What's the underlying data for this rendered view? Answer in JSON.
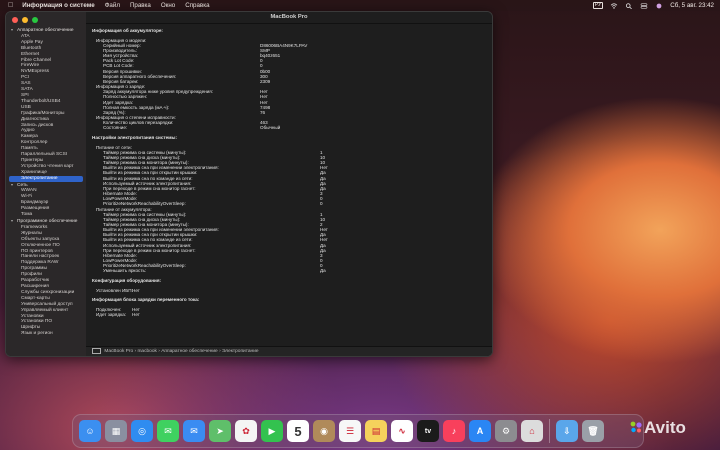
{
  "menubar": {
    "app_name": "Информация о системе",
    "items": [
      "Файл",
      "Правка",
      "Окно",
      "Справка"
    ],
    "input_badge": "РУ",
    "clock": "Сб, 5 авг. 23:42"
  },
  "window": {
    "title": "MacBook Pro",
    "sidebar": [
      {
        "label": "Аппаратное обеспечение",
        "type": "cat"
      },
      {
        "label": "ATA"
      },
      {
        "label": "Apple Pay"
      },
      {
        "label": "Bluetooth"
      },
      {
        "label": "Ethernet"
      },
      {
        "label": "Fibre Channel"
      },
      {
        "label": "FireWire"
      },
      {
        "label": "NVMExpress"
      },
      {
        "label": "PCI"
      },
      {
        "label": "SAS"
      },
      {
        "label": "SATA"
      },
      {
        "label": "SPI"
      },
      {
        "label": "Thunderbolt/USB4"
      },
      {
        "label": "USB"
      },
      {
        "label": "Графика/Мониторы"
      },
      {
        "label": "Диагностика"
      },
      {
        "label": "Запись дисков"
      },
      {
        "label": "Аудио"
      },
      {
        "label": "Камера"
      },
      {
        "label": "Контроллер"
      },
      {
        "label": "Память"
      },
      {
        "label": "Параллельный SCSI"
      },
      {
        "label": "Принтеры"
      },
      {
        "label": "Устройство чтения карт"
      },
      {
        "label": "Хранилище"
      },
      {
        "label": "Электропитание",
        "type": "sel"
      },
      {
        "label": "Сеть",
        "type": "cat"
      },
      {
        "label": "WWAN"
      },
      {
        "label": "Wi-Fi"
      },
      {
        "label": "Брандмауэр"
      },
      {
        "label": "Размещения"
      },
      {
        "label": "Тома"
      },
      {
        "label": "Программное обеспечение",
        "type": "cat"
      },
      {
        "label": "Frameworks"
      },
      {
        "label": "Журналы"
      },
      {
        "label": "Объекты запуска"
      },
      {
        "label": "Отключенное ПО"
      },
      {
        "label": "ПО принтеров"
      },
      {
        "label": "Панели настроек"
      },
      {
        "label": "Поддержка RAW"
      },
      {
        "label": "Программы"
      },
      {
        "label": "Профили"
      },
      {
        "label": "Разработчик"
      },
      {
        "label": "Расширения"
      },
      {
        "label": "Службы синхронизации"
      },
      {
        "label": "Смарт-карты"
      },
      {
        "label": "Универсальный доступ"
      },
      {
        "label": "Управляемый клиент"
      },
      {
        "label": "Установки"
      },
      {
        "label": "Установки ПО"
      },
      {
        "label": "Шрифты"
      },
      {
        "label": "Язык и регион"
      }
    ],
    "rows": [
      {
        "k": "Информация об аккумуляторе:",
        "v": "",
        "ind": 0,
        "h": true
      },
      {
        "gap": true
      },
      {
        "k": "Информация о модели:",
        "v": "",
        "ind": 1
      },
      {
        "k": "Серийный номер:",
        "v": "D86006BA4N9K7LPAV",
        "ind": 2
      },
      {
        "k": "Производитель:",
        "v": "SMP",
        "ind": 2
      },
      {
        "k": "Имя устройства:",
        "v": "bq40z651",
        "ind": 2
      },
      {
        "k": "Pack Lot Code:",
        "v": "0",
        "ind": 2
      },
      {
        "k": "PCB Lot Code:",
        "v": "0",
        "ind": 2
      },
      {
        "k": "Версия прошивки:",
        "v": "0b00",
        "ind": 2
      },
      {
        "k": "Версия аппаратного обеспечения:",
        "v": "300",
        "ind": 2
      },
      {
        "k": "Версия батареи:",
        "v": "2309",
        "ind": 2
      },
      {
        "k": "Информация о заряде:",
        "v": "",
        "ind": 1
      },
      {
        "k": "Заряд аккумулятора ниже уровня предупреждения:",
        "v": "Нет",
        "ind": 2
      },
      {
        "k": "Полностью заряжен:",
        "v": "Нет",
        "ind": 2
      },
      {
        "k": "Идет зарядка:",
        "v": "Нет",
        "ind": 2
      },
      {
        "k": "Полная емкость заряда (мА·ч):",
        "v": "7498",
        "ind": 2
      },
      {
        "k": "Заряд (%):",
        "v": "76",
        "ind": 2
      },
      {
        "k": "Информация о степени исправности:",
        "v": "",
        "ind": 1
      },
      {
        "k": "Количество циклов перезарядки:",
        "v": "463",
        "ind": 2
      },
      {
        "k": "Состояние:",
        "v": "Обычный",
        "ind": 2
      },
      {
        "gap": true
      },
      {
        "k": "Настройки электропитания системы:",
        "v": "",
        "ind": 0,
        "h": true
      },
      {
        "gap": true
      },
      {
        "k": "Питание от сети:",
        "v": "",
        "ind": 1
      },
      {
        "k": "Таймер режима сна системы (минуты):",
        "v": "1",
        "ind": 2,
        "col": 2
      },
      {
        "k": "Таймер режима сна диска (минуты):",
        "v": "10",
        "ind": 2,
        "col": 2
      },
      {
        "k": "Таймер режима сна монитора (минуты):",
        "v": "10",
        "ind": 2,
        "col": 2
      },
      {
        "k": "Выйти из режима сна при изменении электропитания:",
        "v": "Нет",
        "ind": 2,
        "col": 2
      },
      {
        "k": "Выйти из режима сна при открытии крышки:",
        "v": "Да",
        "ind": 2,
        "col": 2
      },
      {
        "k": "Выйти из режима сна по команде из сети:",
        "v": "Да",
        "ind": 2,
        "col": 2
      },
      {
        "k": "Используемый источник электропитания:",
        "v": "Да",
        "ind": 2,
        "col": 2
      },
      {
        "k": "При переходе в режим сна монитор гаснет:",
        "v": "Да",
        "ind": 2,
        "col": 2
      },
      {
        "k": "Hibernate Mode:",
        "v": "3",
        "ind": 2,
        "col": 2
      },
      {
        "k": "LowPowerMode:",
        "v": "0",
        "ind": 2,
        "col": 2
      },
      {
        "k": "PrioritizeNetworkReachabilityOverSleep:",
        "v": "0",
        "ind": 2,
        "col": 2
      },
      {
        "k": "Питание от аккумулятора:",
        "v": "",
        "ind": 1
      },
      {
        "k": "Таймер режима сна системы (минуты):",
        "v": "1",
        "ind": 2,
        "col": 2
      },
      {
        "k": "Таймер режима сна диска (минуты):",
        "v": "10",
        "ind": 2,
        "col": 2
      },
      {
        "k": "Таймер режима сна монитора (минуты):",
        "v": "2",
        "ind": 2,
        "col": 2
      },
      {
        "k": "Выйти из режима сна при изменении электропитания:",
        "v": "Нет",
        "ind": 2,
        "col": 2
      },
      {
        "k": "Выйти из режима сна при открытии крышки:",
        "v": "Да",
        "ind": 2,
        "col": 2
      },
      {
        "k": "Выйти из режима сна по команде из сети:",
        "v": "Нет",
        "ind": 2,
        "col": 2
      },
      {
        "k": "Используемый источник электропитания:",
        "v": "Да",
        "ind": 2,
        "col": 2
      },
      {
        "k": "При переходе в режим сна монитор гаснет:",
        "v": "Да",
        "ind": 2,
        "col": 2
      },
      {
        "k": "Hibernate Mode:",
        "v": "3",
        "ind": 2,
        "col": 2
      },
      {
        "k": "LowPowerMode:",
        "v": "0",
        "ind": 2,
        "col": 2
      },
      {
        "k": "PrioritizeNetworkReachabilityOverSleep:",
        "v": "0",
        "ind": 2,
        "col": 2
      },
      {
        "k": "Уменьшить яркость:",
        "v": "Да",
        "ind": 2,
        "col": 2
      },
      {
        "gap": true
      },
      {
        "k": "Конфигурация оборудования:",
        "v": "",
        "ind": 0,
        "h": true
      },
      {
        "gap": true
      },
      {
        "k": "Установлен ИБП:",
        "v": "Нет",
        "ind": 1,
        "col": 3
      },
      {
        "gap": true
      },
      {
        "k": "Информация блока зарядки переменного тока:",
        "v": "",
        "ind": 0,
        "h": true
      },
      {
        "gap": true
      },
      {
        "k": "Подключен:",
        "v": "Нет",
        "ind": 1,
        "col": 3
      },
      {
        "k": "Идет зарядка:",
        "v": "Нет",
        "ind": 1,
        "col": 3
      }
    ],
    "pathbar": {
      "computer": "MacBook Pro",
      "user": "macbook",
      "section": "Аппаратное обеспечение",
      "item": "Электропитание",
      "sep": "›"
    }
  },
  "dock": {
    "apps": [
      {
        "name": "finder-icon",
        "color": "#3b8ff0",
        "glyph": "☺"
      },
      {
        "name": "launchpad-icon",
        "color": "#8a8fa0",
        "glyph": "▦"
      },
      {
        "name": "safari-icon",
        "color": "#2f8cf0",
        "glyph": "◎"
      },
      {
        "name": "messages-icon",
        "color": "#3fd160",
        "glyph": "✉"
      },
      {
        "name": "mail-icon",
        "color": "#3a8cf2",
        "glyph": "✉"
      },
      {
        "name": "maps-icon",
        "color": "#5fbf6a",
        "glyph": "➤"
      },
      {
        "name": "photos-icon",
        "color": "#f4f4f4",
        "glyph": "✿"
      },
      {
        "name": "facetime-icon",
        "color": "#33c24f",
        "glyph": "▶"
      },
      {
        "name": "calendar-icon",
        "color": "#ffffff",
        "glyph": "5"
      },
      {
        "name": "contacts-icon",
        "color": "#b08a5a",
        "glyph": "◉"
      },
      {
        "name": "reminders-icon",
        "color": "#f7f7f7",
        "glyph": "☰"
      },
      {
        "name": "notes-icon",
        "color": "#f5d25c",
        "glyph": "▤"
      },
      {
        "name": "freeform-icon",
        "color": "#ffffff",
        "glyph": "∿"
      },
      {
        "name": "appletv-icon",
        "color": "#1b1b1b",
        "glyph": "tv"
      },
      {
        "name": "music-icon",
        "color": "#f8405c",
        "glyph": "♪"
      },
      {
        "name": "appstore-icon",
        "color": "#2a86f4",
        "glyph": "A"
      },
      {
        "name": "settings-icon",
        "color": "#8c8c90",
        "glyph": "⚙"
      },
      {
        "name": "sysinfo-icon",
        "color": "#dcdcdc",
        "glyph": "⌂"
      },
      {
        "name": "downloads-icon",
        "color": "#5aa6ea",
        "glyph": "⇩"
      },
      {
        "name": "trash-icon",
        "color": "#9aa0a8",
        "glyph": "🗑"
      }
    ]
  },
  "watermark": "Avito"
}
